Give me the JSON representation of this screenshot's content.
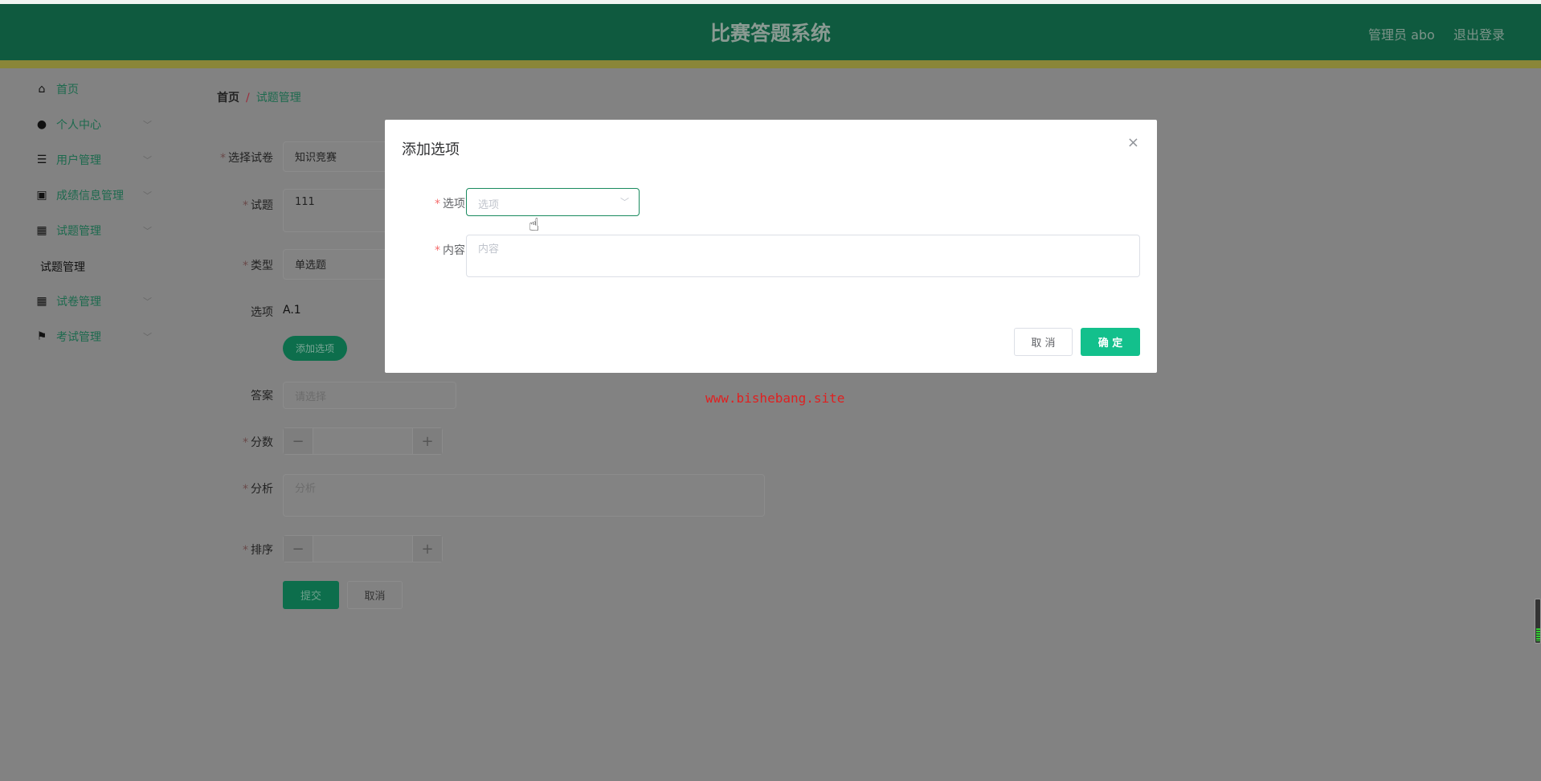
{
  "header": {
    "title": "比赛答题系统",
    "user": "管理员 abo",
    "logout": "退出登录"
  },
  "sidebar": {
    "items": [
      {
        "label": "首页",
        "icon": "home-icon"
      },
      {
        "label": "个人中心",
        "icon": "user-icon"
      },
      {
        "label": "用户管理",
        "icon": "list-icon"
      },
      {
        "label": "成绩信息管理",
        "icon": "clipboard-icon"
      },
      {
        "label": "试题管理",
        "icon": "grid-icon"
      },
      {
        "label": "试卷管理",
        "icon": "grid-icon"
      },
      {
        "label": "考试管理",
        "icon": "flag-icon"
      }
    ],
    "sub_item": "试题管理"
  },
  "breadcrumb": {
    "home": "首页",
    "sep": "/",
    "current": "试题管理"
  },
  "form": {
    "paper_label": "选择试卷",
    "paper_value": "知识竞赛",
    "question_label": "试题",
    "question_value": "111",
    "type_label": "类型",
    "type_value": "单选题",
    "options_label": "选项",
    "options_value": "A.1",
    "add_option": "添加选项",
    "answer_label": "答案",
    "answer_placeholder": "请选择",
    "score_label": "分数",
    "analysis_label": "分析",
    "analysis_placeholder": "分析",
    "order_label": "排序",
    "minus": "−",
    "plus": "+",
    "submit": "提交",
    "cancel": "取消"
  },
  "modal": {
    "title": "添加选项",
    "close": "×",
    "option_label": "选项",
    "option_placeholder": "选项",
    "content_label": "内容",
    "content_placeholder": "内容",
    "cancel": "取 消",
    "confirm": "确 定",
    "required": "*"
  },
  "watermark": "www.bishebang.site"
}
